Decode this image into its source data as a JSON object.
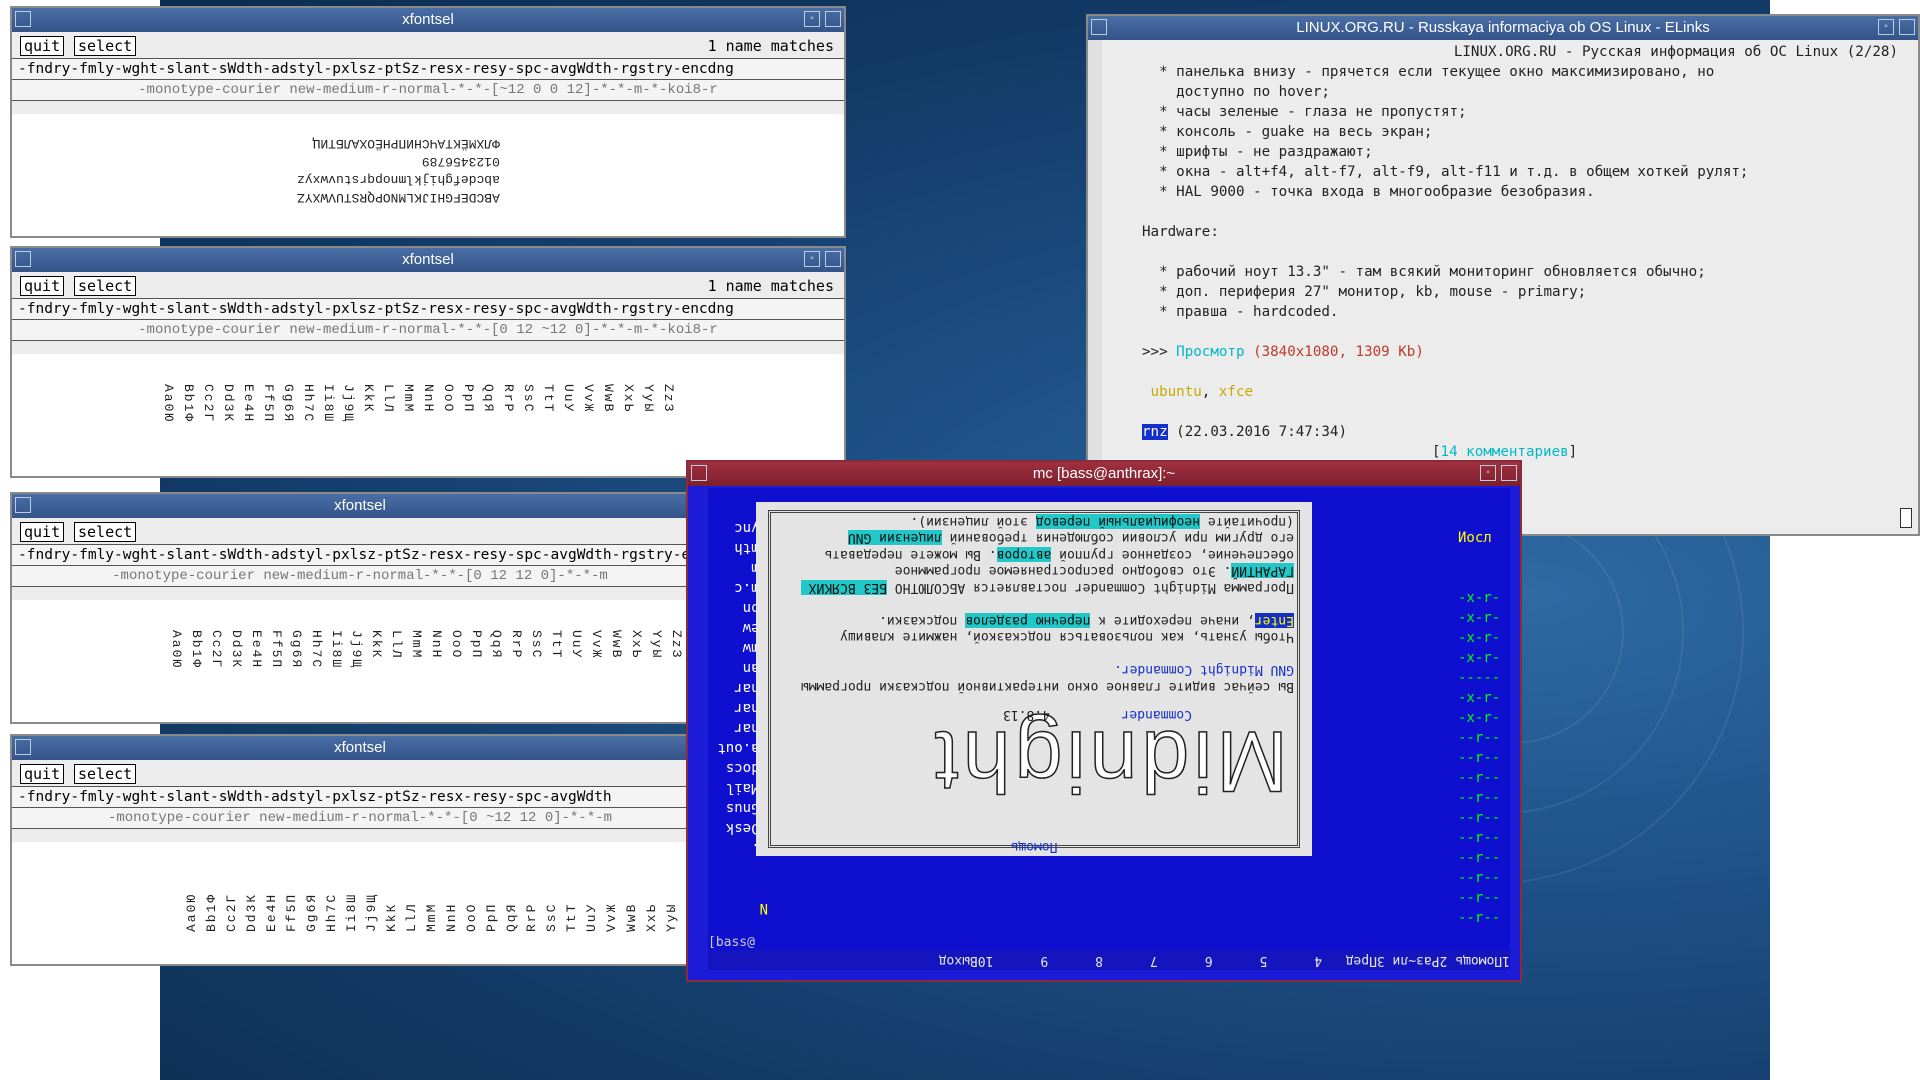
{
  "xfontsel": [
    {
      "title": "xfontsel",
      "quit": "quit",
      "select": "select",
      "matches": "1 name matches",
      "pattern": "-fndry-fmly-wght-slant-sWdth-adstyl-pxlsz-ptSz-resx-resy-spc-avgWdth-rgstry-encdng",
      "fontname": "-monotype-courier new-medium-r-normal-*-*-[~12 0 0 12]-*-*-m-*-koi8-r",
      "sample_lines": [
        "ABCDEFGHIJKLMNOPQRSTUVWXYZ",
        "abcdefghijklmnopqrstuvwxyz",
        "0123456789",
        "ФЛХМЁКТАЧСНИПРНЁОХАЛБТИЦ"
      ]
    },
    {
      "title": "xfontsel",
      "quit": "quit",
      "select": "select",
      "matches": "1 name matches",
      "pattern": "-fndry-fmly-wght-slant-sWdth-adstyl-pxlsz-ptSz-resx-resy-spc-avgWdth-rgstry-encdng",
      "fontname": "-monotype-courier new-medium-r-normal-*-*-[0 12 ~12 0]-*-*-m-*-koi8-r",
      "sample_cols": [
        "Aa0Ю",
        "Bb1Ф",
        "Cc2Г",
        "Dd3К",
        "Ee4Н",
        "Ff5П",
        "Gg6Я",
        "Hh7С",
        "Ii8Ш",
        "Jj9Щ",
        "KkК",
        "LlЛ",
        "MmМ",
        "NnН",
        "OoО",
        "PpП",
        "QqЯ",
        "RrР",
        "SsС",
        "TtТ",
        "UuУ",
        "VvЖ",
        "WwВ",
        "XxЬ",
        "YyЫ",
        "ZzЗ"
      ]
    },
    {
      "title": "xfontsel",
      "quit": "quit",
      "select": "select",
      "pattern": "-fndry-fmly-wght-slant-sWdth-adstyl-pxlsz-ptSz-resx-resy-spc-avgWdth-rgstry-encdng",
      "fontname": "-monotype-courier new-medium-r-normal-*-*-[0 12 12 0]-*-*-m",
      "sample_cols": [
        "Aa0Ю",
        "Bb1Ф",
        "Cc2Г",
        "Dd3К",
        "Ee4Н",
        "Ff5П",
        "Gg6Я",
        "Hh7С",
        "Ii8Ш",
        "Jj9Щ",
        "KkК",
        "LlЛ",
        "MmМ",
        "NnН",
        "OoО",
        "PpП",
        "QqЯ",
        "RrР",
        "SsС",
        "TtТ",
        "UuУ",
        "VvЖ",
        "WwВ",
        "XxЬ",
        "YyЫ",
        "ZzЗ"
      ]
    },
    {
      "title": "xfontsel",
      "quit": "quit",
      "select": "select",
      "pattern": "-fndry-fmly-wght-slant-sWdth-adstyl-pxlsz-ptSz-resx-resy-spc-avgWdth",
      "fontname": "-monotype-courier new-medium-r-normal-*-*-[0 ~12 12 0]-*-*-m",
      "sample_cols": [
        "Aa0Ю",
        "Bb1Ф",
        "Cc2Г",
        "Dd3К",
        "Ee4Н",
        "Ff5П",
        "Gg6Я",
        "Hh7С",
        "Ii8Ш",
        "Jj9Щ",
        "KkК",
        "LlЛ",
        "MmМ",
        "NnН",
        "OoО",
        "PpП",
        "QqЯ",
        "RrР",
        "SsС",
        "TtТ",
        "UuУ",
        "VvЖ",
        "WwВ",
        "XxЬ",
        "YyЫ",
        "ZzЗ"
      ]
    }
  ],
  "elinks": {
    "title": "LINUX.ORG.RU - Russkaya informaciya ob OS Linux - ELinks",
    "header": "LINUX.ORG.RU - Русская информация об ОС Linux (2/28)",
    "lines": [
      "  * панелька внизу - прячется если текущее окно максимизировано, но",
      "    доступно по hover;",
      "  * часы зеленые - глаза не пропустят;",
      "  * консоль - guake на весь экран;",
      "  * шрифты - не раздражают;",
      "  * окна - alt+f4, alt-f7, alt-f9, alt-f11 и т.д. в общем хоткей рулят;",
      "  * HAL 9000 - точка входа в многообразие безобразия.",
      "",
      "Hardware:",
      "",
      "  * рабочий ноут 13.3\" - там всякий мониторинг обновляется обычно;",
      "  * доп. периферия 27\" монитор, kb, mouse - primary;",
      "  * правша - hardcoded."
    ],
    "prompt": ">>> ",
    "view_link": "Просмотр",
    "view_meta": "(3840x1080, 1309 Kb)",
    "tag1": "ubuntu",
    "tag2": "xfce",
    "author": "rnz",
    "date": "(22.03.2016 7:47:34)",
    "comments": "14 комментариев"
  },
  "mc": {
    "title": "mc [bass@anthrax]:~",
    "help_title": "Помощь",
    "logo_word": "Midnight",
    "logo_sub": "Commander",
    "version": "4.8.13",
    "help_lines": [
      "Вы сейчас видите главное окно интерактивной подсказки программы",
      "GNU Midnight Commander.",
      "",
      "Чтобы узнать, как пользоваться подсказкой, нажмите клавишу",
      "Enter, иначе переходите к перечню разделов подсказки.",
      "",
      "Программа Midnight Commander поставляется АБСОЛЮТНО БЕЗ ВСЯКИХ",
      "ГАРАНТИЙ. Это свободно распространяемое программное",
      "обеспечение, созданное группой авторов. Вы можете передавать",
      "его другим при условии соблюдения требований лицензии GNU",
      "(прочитайте неофициальный перевод этой лицензии)."
    ],
    "left_items": [
      "..",
      "/Desk",
      "/Gnus",
      "/Mail",
      "/docs",
      "*a.out",
      "char",
      "char",
      "char",
      "man",
      "mmw",
      "new",
      "non",
      "rm.c",
      "rm",
      "smth",
      "sync"
    ],
    "left_header": "N",
    "right_header": "Иосл",
    "right_items": [
      "-x-r-",
      "-x-r-",
      "-x-r-",
      "-x-r-",
      "-----",
      "-x-r-",
      "-x-r-",
      "--r--",
      "--r--",
      "--r--",
      "--r--",
      "--r--",
      "--r--",
      "--r--",
      "--r--",
      "--r--",
      "--r--"
    ],
    "prompt": "[bass@",
    "fkeys": "1Помощь 2Раз~ли 3Пред   4      5      6      7      8      9      10Выход"
  }
}
